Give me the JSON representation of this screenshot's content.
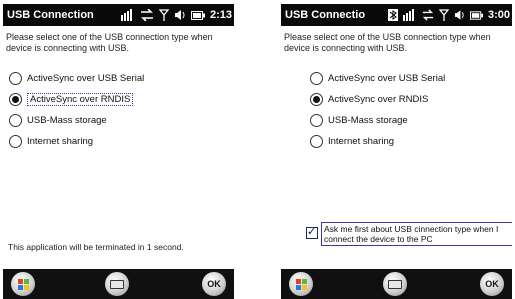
{
  "screens": [
    {
      "title": "USB Connection",
      "clock": "2:13",
      "instruction": "Please select one of the USB connection type when device is connecting with USB.",
      "options": [
        {
          "label": "ActiveSync over USB Serial",
          "selected": false
        },
        {
          "label": "ActiveSync over RNDIS",
          "selected": true,
          "focused": true
        },
        {
          "label": "USB-Mass storage",
          "selected": false
        },
        {
          "label": "Internet sharing",
          "selected": false
        }
      ],
      "footer_text": "This application will be terminated in  1 second.",
      "ok_label": "OK",
      "status_icons": [
        "signal-bars-icon",
        "sync-arrows-icon",
        "antenna-icon",
        "speaker-icon",
        "battery-icon"
      ]
    },
    {
      "title": "USB Connectio",
      "clock": "3:00",
      "instruction": "Please select one of the USB connection type when device is connecting with USB.",
      "options": [
        {
          "label": "ActiveSync over USB Serial",
          "selected": false
        },
        {
          "label": "ActiveSync over RNDIS",
          "selected": true
        },
        {
          "label": "USB-Mass storage",
          "selected": false
        },
        {
          "label": "Internet sharing",
          "selected": false
        }
      ],
      "ask_checkbox": {
        "label": "Ask me first about USB cinnection type when I connect the device to the PC",
        "checked": true
      },
      "ok_label": "OK",
      "status_icons": [
        "bluetooth-icon",
        "signal-bars-icon",
        "sync-arrows-icon",
        "antenna-icon",
        "speaker-icon",
        "battery-icon"
      ]
    }
  ],
  "colors": {
    "titlebar_bg": "#0a0a0a",
    "focus_border": "#3a3aa0",
    "softkey_bar": "#101010"
  }
}
